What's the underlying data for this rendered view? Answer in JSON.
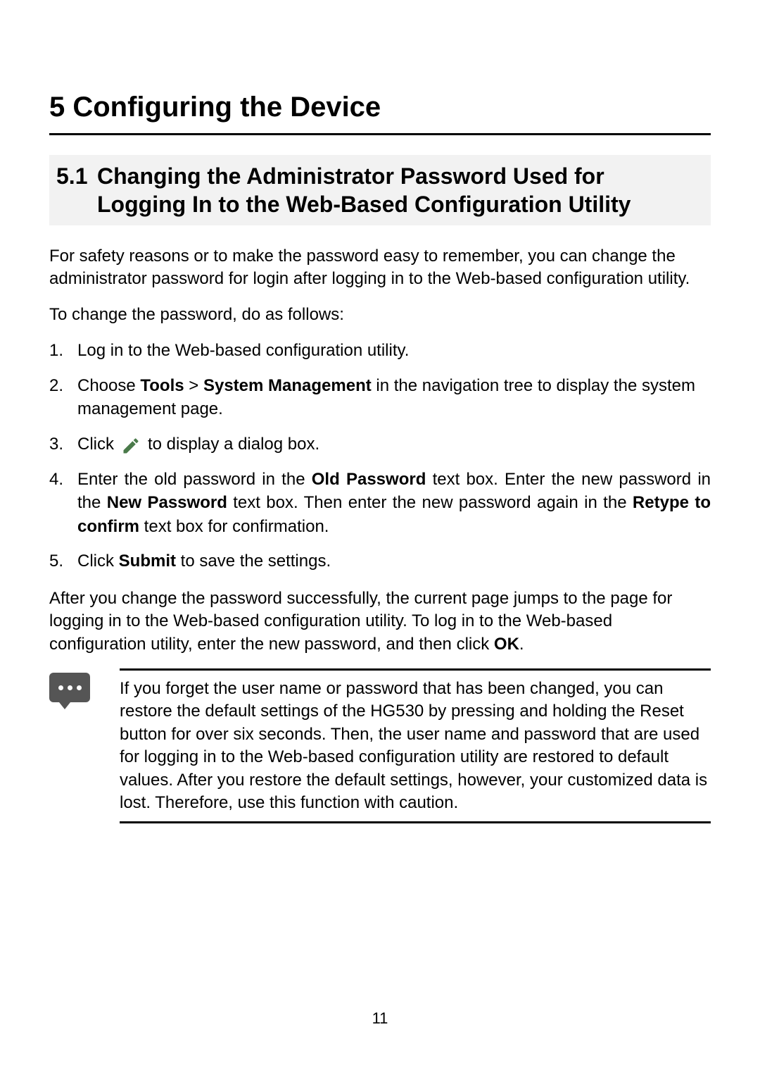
{
  "page_number": "11",
  "h1": "5 Configuring the Device",
  "h2_num": "5.1",
  "h2_title": "Changing the Administrator Password Used for Logging In to the Web-Based Configuration Utility",
  "intro": "For safety reasons or to make the password easy to remember, you can change the administrator password for login after logging in to the Web-based configuration utility.",
  "intro2": "To change the password, do as follows:",
  "steps": {
    "s1": "Log in to the Web-based configuration utility.",
    "s2_a": "Choose ",
    "s2_b_bold": "Tools",
    "s2_c": " > ",
    "s2_d_bold": "System Management",
    "s2_e": " in the navigation tree to display the system management page.",
    "s3_a": "Click",
    "s3_b": "to display a dialog box.",
    "s4_a": "Enter the old password in the ",
    "s4_b_bold": "Old Password",
    "s4_c": " text box. Enter the new password in the ",
    "s4_d_bold": "New Password",
    "s4_e": " text box. Then enter the new password again in the ",
    "s4_f_bold": "Retype to confirm",
    "s4_g": " text box for confirmation.",
    "s5_a": "Click ",
    "s5_b_bold": "Submit",
    "s5_c": " to save the settings."
  },
  "after_a": "After you change the password successfully, the current page jumps to the page for logging in to the Web-based configuration utility. To log in to the Web-based configuration utility, enter the new password, and then click ",
  "after_b_bold": "OK",
  "after_c": ".",
  "note": "If you forget the user name or password that has been changed, you can restore the default settings of the HG530 by pressing and holding the Reset button for over six seconds. Then, the user name and password that are used for logging in to the Web-based configuration utility are restored to default values. After you restore the default settings, however, your customized data is lost. Therefore, use this function with caution."
}
